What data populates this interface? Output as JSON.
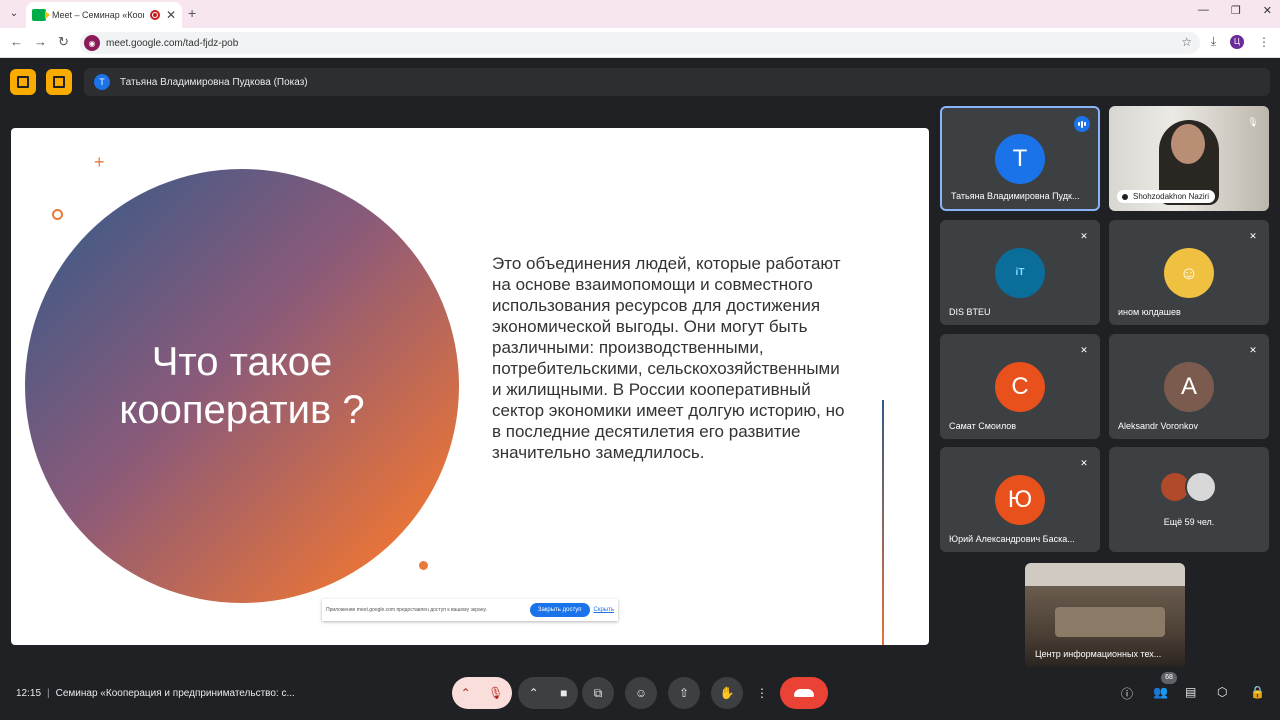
{
  "browser": {
    "tab_title": "Meet – Семинар «Коопера",
    "url": "meet.google.com/tad-fjdz-pob",
    "profile_initial": "Ц"
  },
  "meet": {
    "presenter_initial": "Т",
    "presenter_label": "Татьяна Владимировна Пудкова (Показ)"
  },
  "slide": {
    "title": "Что такое кооператив ?",
    "body": "Это объединения людей, которые работают на основе взаимопомощи и совместного использования ресурсов для достижения экономической выгоды. Они могут быть различными: производственными, потребительскими, сельскохозяйственными и жилищными. В России кооперативный сектор экономики имеет долгую историю, но в последние десятилетия его развитие значительно замедлилось.",
    "share_notice": "Приложение meet.google.com предоставлен доступ к вашему экрану.",
    "share_stop": "Закрыть доступ",
    "share_hide": "Скрыть"
  },
  "participants": [
    {
      "name": "Татьяна Владимировна Пудк...",
      "initial": "Т",
      "color": "#1a73e8"
    },
    {
      "name": "Shohzodakhon Naziri"
    },
    {
      "name": "DIS BTEU"
    },
    {
      "name": "ином юлдашев"
    },
    {
      "name": "Самат Смоилов",
      "initial": "С",
      "color": "#e8501c"
    },
    {
      "name": "Aleksandr Voronkov",
      "initial": "A",
      "color": "#7b5b4e"
    },
    {
      "name": "Юрий Александрович Баска...",
      "initial": "Ю",
      "color": "#e8501c"
    },
    {
      "name": "Ещё 59 чел."
    }
  ],
  "room_tile": {
    "name": "Центр информационных тех..."
  },
  "bottom": {
    "time": "12:15",
    "meeting_title": "Семинар «Кооперация и предпринимательство: с...",
    "people_count": "68"
  },
  "colors": {
    "accent": "#1a73e8",
    "end_call": "#ea4335",
    "slide_orange": "#e97a3a"
  }
}
